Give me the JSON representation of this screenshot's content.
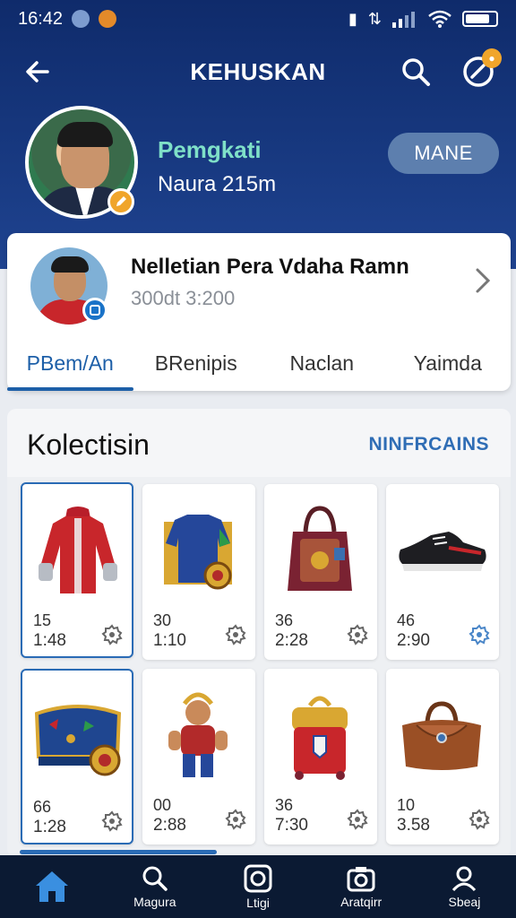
{
  "status_bar": {
    "time": "16:42",
    "icons": [
      "blue-dot-icon",
      "orange-dot-icon",
      "nfc-icon",
      "data-icon",
      "signal-icon",
      "wifi-icon",
      "battery-icon"
    ]
  },
  "app_bar": {
    "title": "KEHUSKAN",
    "icons": [
      "back-arrow-icon",
      "search-icon",
      "notification-icon"
    ]
  },
  "profile": {
    "name": "Pemgkati",
    "subtitle": "Naura 215m",
    "manage_label": "MANE"
  },
  "featured_card": {
    "title": "Nelletian Pera Vdaha Ramn",
    "subtitle": "300dt 3:200",
    "tabs": [
      {
        "label": "PBem/An",
        "active": true
      },
      {
        "label": "BRenipis",
        "active": false
      },
      {
        "label": "Naclan",
        "active": false
      },
      {
        "label": "Yaimda",
        "active": false
      }
    ]
  },
  "collection": {
    "title": "Kolectisin",
    "link_label": "NINFRCAINS",
    "items": [
      {
        "icon": "red-jersey-icon",
        "line1": "15",
        "line2": "1:48"
      },
      {
        "icon": "blue-jersey-icon",
        "line1": "30",
        "line2": "1:10"
      },
      {
        "icon": "handbag-icon",
        "line1": "36",
        "line2": "2:28"
      },
      {
        "icon": "sneaker-icon",
        "line1": "46",
        "line2": "2:90"
      },
      {
        "icon": "treasure-case-icon",
        "line1": "66",
        "line2": "1:28"
      },
      {
        "icon": "figurine-icon",
        "line1": "00",
        "line2": "2:88"
      },
      {
        "icon": "backpack-icon",
        "line1": "36",
        "line2": "7:30"
      },
      {
        "icon": "leather-bag-icon",
        "line1": "10",
        "line2": "3.58"
      }
    ]
  },
  "bottom_nav": {
    "items": [
      {
        "icon": "home-icon",
        "label": ""
      },
      {
        "icon": "search-icon",
        "label": "Magura"
      },
      {
        "icon": "disc-icon",
        "label": "Ltigi"
      },
      {
        "icon": "camera-icon",
        "label": "Aratqirr"
      },
      {
        "icon": "profile-icon",
        "label": "Sbeaj"
      }
    ]
  },
  "colors": {
    "header_blue": "#17387f",
    "accent_blue": "#1d5fa8",
    "badge_orange": "#f0a52b",
    "name_teal": "#7fe0c8",
    "nav_dark": "#0b1a33"
  }
}
